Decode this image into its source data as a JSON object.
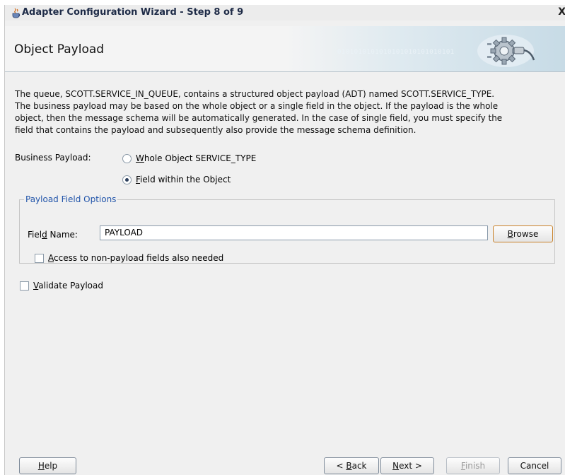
{
  "window": {
    "title": "Adapter Configuration Wizard - Step 8 of 9",
    "close_symbol": "X"
  },
  "header": {
    "step_title": "Object Payload",
    "binary_text": "0101010101010101010101010101",
    "icon": "gear-plug-icon"
  },
  "description": {
    "lines": [
      "The queue, SCOTT.SERVICE_IN_QUEUE, contains a structured object payload (ADT) named SCOTT.SERVICE_TYPE.",
      "The business payload may be based on the whole object or a single field in the object. If the payload is the whole",
      "object, then the message schema will be automatically generated. In the case of single field, you must specify the",
      "field that contains the payload and subsequently also provide the message schema definition."
    ]
  },
  "business_payload": {
    "label": "Business Payload:",
    "options": [
      {
        "mnemonic": "W",
        "rest": "hole Object SERVICE_TYPE",
        "checked": false
      },
      {
        "mnemonic": "F",
        "rest": "ield within the Object",
        "checked": true
      }
    ]
  },
  "payload_field_options": {
    "legend": "Payload Field Options",
    "field_label_pre": "Fiel",
    "field_label_mnemonic": "d",
    "field_label_post": " Name:",
    "field_value": "PAYLOAD",
    "browse_mnemonic": "B",
    "browse_rest": "rowse",
    "access_mnemonic": "A",
    "access_rest": "ccess to non-payload fields also needed",
    "access_checked": false
  },
  "validate": {
    "mnemonic": "V",
    "rest": "alidate Payload",
    "checked": false
  },
  "footer": {
    "help_mnemonic": "H",
    "help_rest": "elp",
    "back_pre": "< ",
    "back_mnemonic": "B",
    "back_rest": "ack",
    "next_mnemonic": "N",
    "next_rest": "ext >",
    "finish_mnemonic": "F",
    "finish_rest": "inish",
    "cancel_label": "Cancel"
  }
}
